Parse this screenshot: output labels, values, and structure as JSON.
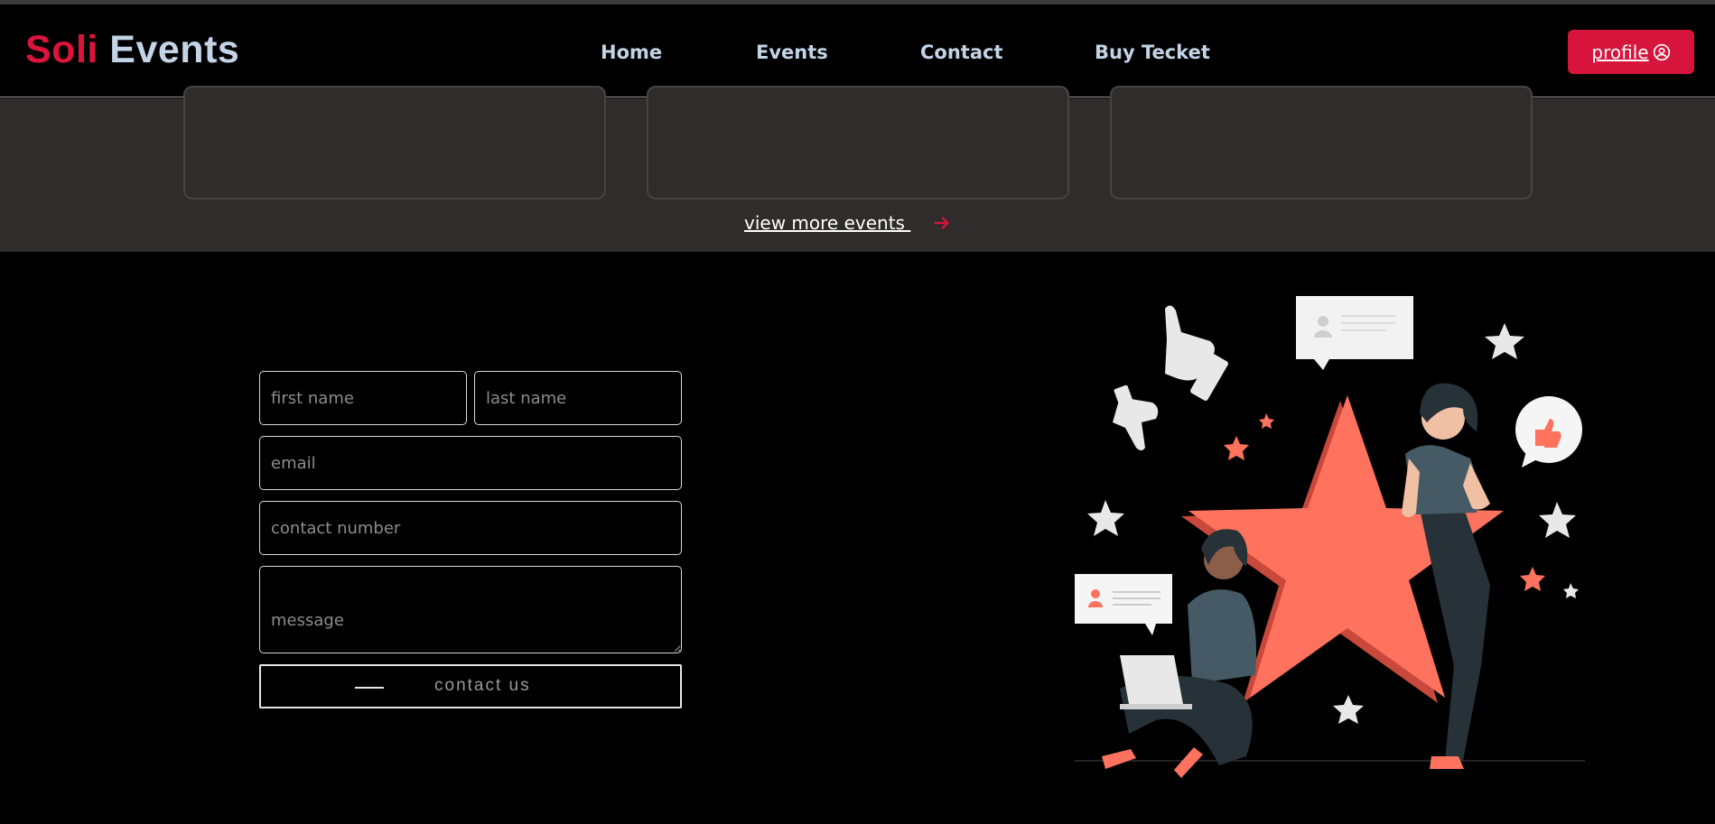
{
  "header": {
    "logo_part1": "Soli",
    "logo_part2": "Events",
    "nav": [
      "Home",
      "Events",
      "Contact",
      "Buy Tecket"
    ],
    "profile_label": "profile"
  },
  "events_section": {
    "view_more_label": "view more events "
  },
  "contact_form": {
    "first_name_placeholder": "first name",
    "last_name_placeholder": "last name",
    "email_placeholder": "email",
    "contact_number_placeholder": "contact number",
    "message_placeholder": "message",
    "submit_label": "contact us"
  },
  "colors": {
    "brand_red": "#dc143c",
    "nav_text": "#c2d4e6",
    "band_bg": "#302c2c",
    "illustration_accent": "#ff725e"
  },
  "icons": [
    "user-circle-icon",
    "arrow-right-icon"
  ]
}
